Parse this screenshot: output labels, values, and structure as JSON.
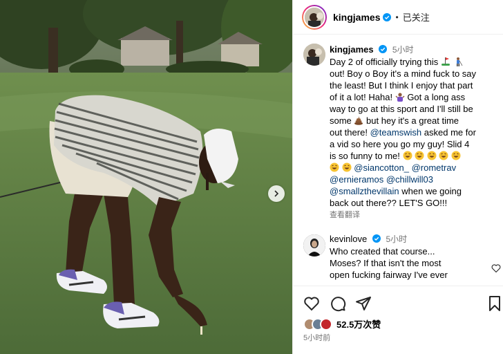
{
  "colors": {
    "verified": "#0095f6",
    "mention": "#00376b",
    "secondary_text": "#737373",
    "grass": "#5c7a45"
  },
  "media": {
    "next_icon": "chevron-right-icon"
  },
  "header": {
    "username": "kingjames",
    "separator": "•",
    "follow_status": "已关注"
  },
  "post": {
    "username": "kingjames",
    "time": "5小时",
    "lines": {
      "l1": "Day 2 of officially trying this",
      "l2": "out! Boy o Boy it's a mind fuck to say",
      "l3": "the least! But I think I enjoy that part",
      "l4": "of it a lot! Haha!",
      "l5": "Got a long ass",
      "l6": "way to go at this sport and I'll still be",
      "l7a": "some",
      "l7b": "but hey it's a great time",
      "l8a": "out there!",
      "l8m": "@teamswish",
      "l8b": "asked me for",
      "l9": "a vid so here you go my guy! Slid 4",
      "l10": "is so funny to me!",
      "l11m1": "@siancotton_",
      "l11m2": "@rometrav",
      "l12m1": "@ernieramos",
      "l12m2": "@chillwill03",
      "l13m": "@smallzthevillain",
      "l13b": "when we going",
      "l14": "back out there?? LET'S GO!!!"
    },
    "see_translation": "查看翻译"
  },
  "comment": {
    "username": "kevinlove",
    "time": "5小时",
    "text_lines": [
      "Who created that course...",
      "Moses? If that isn't the most",
      "open fucking fairway I've ever"
    ]
  },
  "actions": {
    "likes_text": "52.5万次赞",
    "posted_time": "5小时前"
  }
}
